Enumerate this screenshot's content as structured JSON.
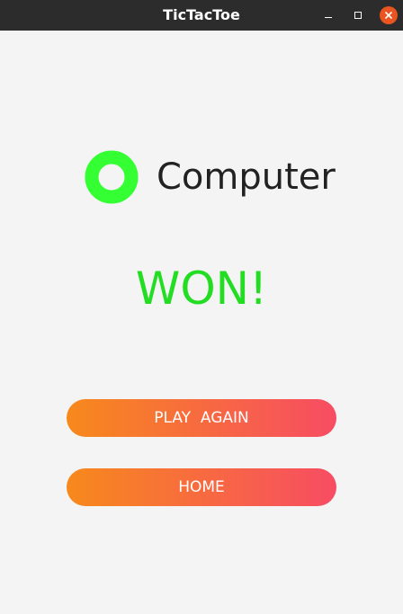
{
  "window": {
    "title": "TicTacToe"
  },
  "result": {
    "player_icon": "o-ring-icon",
    "player_icon_color": "#33ff33",
    "player_name": "Computer",
    "status": "WON!",
    "status_color": "#22dd22"
  },
  "actions": {
    "play_again_label": "PLAY  AGAIN",
    "home_label": "HOME",
    "gradient_start": "#f7891c",
    "gradient_end": "#f74c63"
  }
}
